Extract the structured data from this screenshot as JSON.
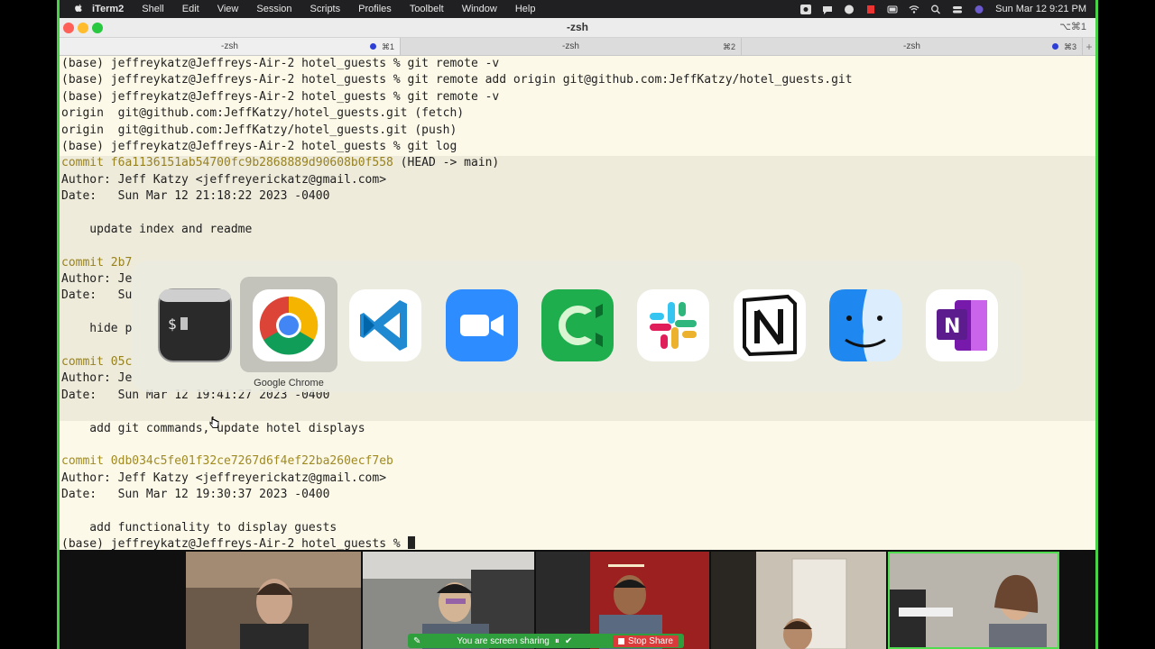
{
  "menubar": {
    "app": "iTerm2",
    "items": [
      "Shell",
      "Edit",
      "View",
      "Session",
      "Scripts",
      "Profiles",
      "Toolbelt",
      "Window",
      "Help"
    ],
    "clock": "Sun Mar 12  9:21 PM"
  },
  "window": {
    "title": "-zsh",
    "shortcut": "⌥⌘1"
  },
  "tabs": [
    {
      "label": "-zsh",
      "shortcut": "⌘1",
      "active": true,
      "dot": true
    },
    {
      "label": "-zsh",
      "shortcut": "⌘2",
      "active": false,
      "dot": false
    },
    {
      "label": "-zsh",
      "shortcut": "⌘3",
      "active": false,
      "dot": true
    }
  ],
  "terminal": {
    "lines": [
      {
        "text": "(base) jeffreykatz@Jeffreys-Air-2 hotel_guests % git remote -v"
      },
      {
        "text": "(base) jeffreykatz@Jeffreys-Air-2 hotel_guests % git remote add origin git@github.com:JeffKatzy/hotel_guests.git"
      },
      {
        "text": "(base) jeffreykatz@Jeffreys-Air-2 hotel_guests % git remote -v"
      },
      {
        "text": "origin  git@github.com:JeffKatzy/hotel_guests.git (fetch)"
      },
      {
        "text": "origin  git@github.com:JeffKatzy/hotel_guests.git (push)"
      },
      {
        "text": "(base) jeffreykatz@Jeffreys-Air-2 hotel_guests % git log"
      },
      {
        "commit": "commit f6a1136151ab54700fc9b2868889d90608b0f558",
        "ref": " (HEAD -> main)"
      },
      {
        "text": "Author: Jeff Katzy <jeffreyerickatz@gmail.com>"
      },
      {
        "text": "Date:   Sun Mar 12 21:18:22 2023 -0400"
      },
      {
        "text": ""
      },
      {
        "text": "    update index and readme"
      },
      {
        "text": ""
      },
      {
        "commit": "commit 2b7",
        "ref": ""
      },
      {
        "text": "Author: Je"
      },
      {
        "text": "Date:   Su"
      },
      {
        "text": ""
      },
      {
        "text": "    hide p"
      },
      {
        "text": ""
      },
      {
        "commit": "commit 05c",
        "ref": ""
      },
      {
        "text": "Author: Je"
      },
      {
        "text": "Date:   Sun Mar 12 19:41:27 2023 -0400"
      },
      {
        "text": ""
      },
      {
        "text": "    add git commands, update hotel displays"
      },
      {
        "text": ""
      },
      {
        "commit": "commit 0db034c5fe01f32ce7267d6f4ef22ba260ecf7eb",
        "ref": ""
      },
      {
        "text": "Author: Jeff Katzy <jeffreyerickatz@gmail.com>"
      },
      {
        "text": "Date:   Sun Mar 12 19:30:37 2023 -0400"
      },
      {
        "text": ""
      },
      {
        "text": "    add functionality to display guests"
      },
      {
        "text": "(base) jeffreykatz@Jeffreys-Air-2 hotel_guests % ",
        "cursor": true
      }
    ]
  },
  "switcher": {
    "selected_label": "Google Chrome",
    "apps": [
      "terminal-icon",
      "chrome-icon",
      "vscode-icon",
      "zoom-icon",
      "camtasia-icon",
      "slack-icon",
      "notion-icon",
      "finder-icon",
      "onenote-icon"
    ]
  },
  "zoom": {
    "sharing_text": "You are screen sharing",
    "stop_label": "Stop Share",
    "participants": 5
  },
  "colors": {
    "share_border": "#3fbf3f",
    "terminal_bg": "#fcf9e8",
    "commit_hash": "#a08a22"
  }
}
